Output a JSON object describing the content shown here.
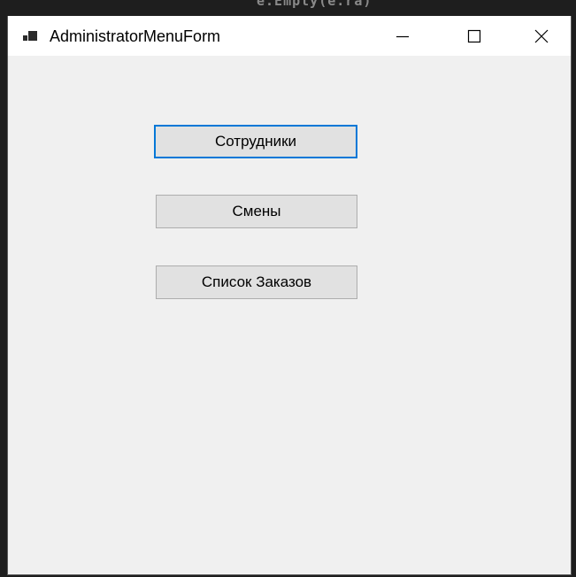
{
  "window": {
    "title": "AdministratorMenuForm",
    "app_icon": "app-window-icon",
    "controls": {
      "minimize": "minimize-icon",
      "maximize": "maximize-icon",
      "close": "close-icon"
    }
  },
  "background": {
    "code_fragment": "e.Empty(e.ra)"
  },
  "menu": {
    "employees_label": "Сотрудники",
    "shifts_label": "Смены",
    "orders_label": "Список Заказов"
  },
  "colors": {
    "focus_border": "#0078d7",
    "button_face": "#e1e1e1",
    "form_background": "#f0f0f0",
    "titlebar": "#ffffff"
  }
}
